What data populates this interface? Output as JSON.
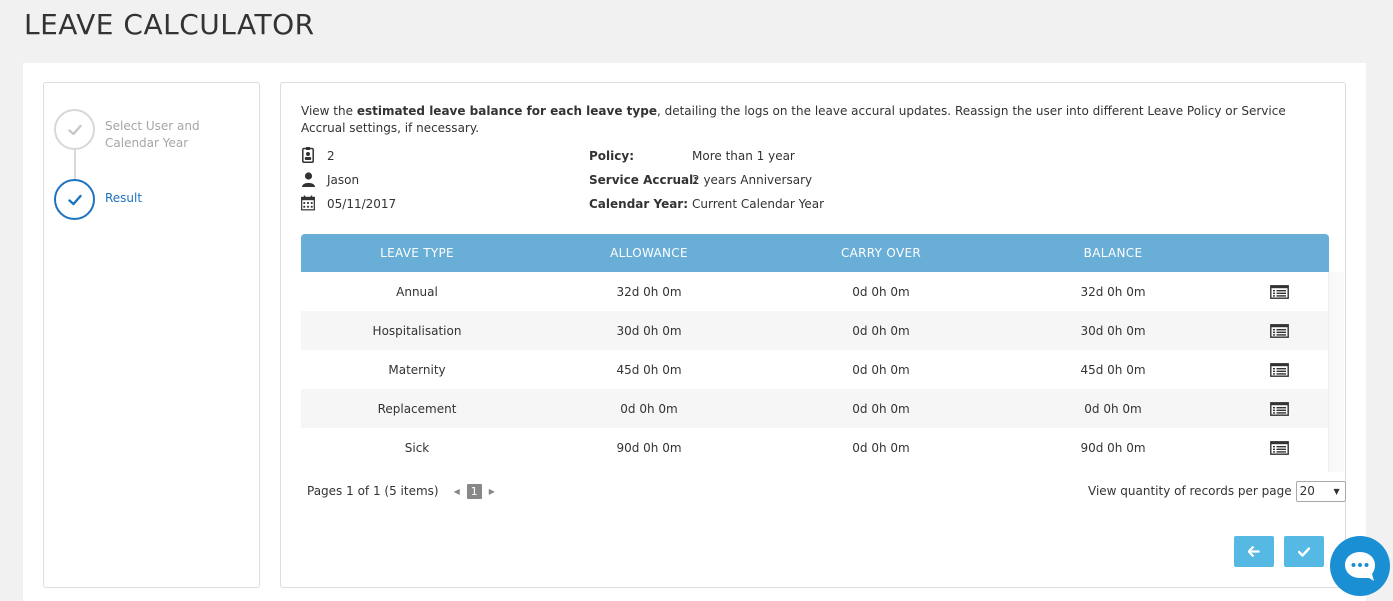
{
  "page": {
    "title": "LEAVE CALCULATOR"
  },
  "steps": [
    {
      "label_line1": "Select User and",
      "label_line2": "Calendar Year",
      "state": "done"
    },
    {
      "label": "Result",
      "state": "active"
    }
  ],
  "description": {
    "pre": "View the ",
    "bold": "estimated leave balance for each leave type",
    "post": ", detailing the logs on the leave accural updates. Reassign the user into different Leave Policy or Service Accrual settings, if necessary."
  },
  "info": {
    "id_value": "2",
    "name_value": "Jason",
    "date_value": "05/11/2017",
    "policy_label": "Policy:",
    "policy_value": "More than 1 year",
    "service_label": "Service Accrual:",
    "service_value": "2 years Anniversary",
    "calendar_label": "Calendar Year:",
    "calendar_value": "Current Calendar Year"
  },
  "table": {
    "headers": [
      "LEAVE TYPE",
      "ALLOWANCE",
      "CARRY OVER",
      "BALANCE"
    ],
    "rows": [
      {
        "type": "Annual",
        "allowance": "32d 0h 0m",
        "carry": "0d 0h 0m",
        "balance": "32d 0h 0m"
      },
      {
        "type": "Hospitalisation",
        "allowance": "30d 0h 0m",
        "carry": "0d 0h 0m",
        "balance": "30d 0h 0m"
      },
      {
        "type": "Maternity",
        "allowance": "45d 0h 0m",
        "carry": "0d 0h 0m",
        "balance": "45d 0h 0m"
      },
      {
        "type": "Replacement",
        "allowance": "0d 0h 0m",
        "carry": "0d 0h 0m",
        "balance": "0d 0h 0m"
      },
      {
        "type": "Sick",
        "allowance": "90d 0h 0m",
        "carry": "0d 0h 0m",
        "balance": "90d 0h 0m"
      }
    ]
  },
  "pager": {
    "summary": "Pages 1 of 1 (5 items)",
    "current_page": "1",
    "per_page_label": "View quantity of records per page",
    "per_page_value": "20"
  },
  "colors": {
    "header_bg": "#68aed6",
    "button_bg": "#55b9e4",
    "step_active": "#1e73be",
    "chat_bg": "#1a8fd3"
  },
  "icons": {
    "id": "id-badge-icon",
    "user": "user-icon",
    "calendar": "calendar-icon",
    "details": "list-details-icon",
    "back": "arrow-left-icon",
    "confirm": "check-icon",
    "chat": "chat-bubble-icon"
  }
}
